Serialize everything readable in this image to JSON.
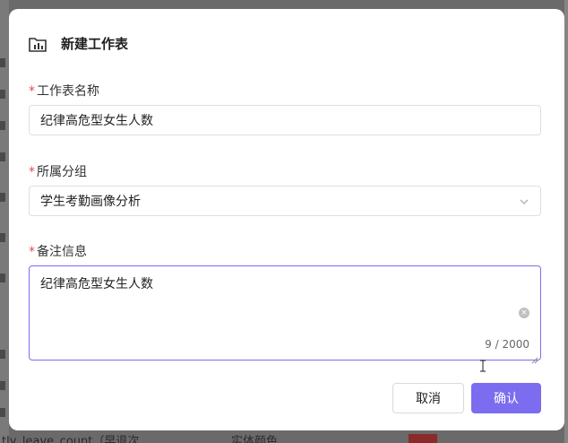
{
  "background": {
    "text_left": "tly_leave_count（早退次",
    "text_right": "实体颜色"
  },
  "dialog": {
    "title": "新建工作表",
    "name_field": {
      "label": "工作表名称",
      "required": "*",
      "value": "纪律高危型女生人数"
    },
    "group_field": {
      "label": "所属分组",
      "required": "*",
      "value": "学生考勤画像分析"
    },
    "note_field": {
      "label": "备注信息",
      "required": "*",
      "value": "纪律高危型女生人数",
      "counter": "9 / 2000"
    },
    "cancel_label": "取消",
    "confirm_label": "确认"
  },
  "colors": {
    "primary": "#7b6cf0",
    "required": "#e5484d"
  },
  "icons": {
    "header": "chart-sheet-icon",
    "select": "chevron-down-icon",
    "clear": "clear-circle-icon"
  }
}
